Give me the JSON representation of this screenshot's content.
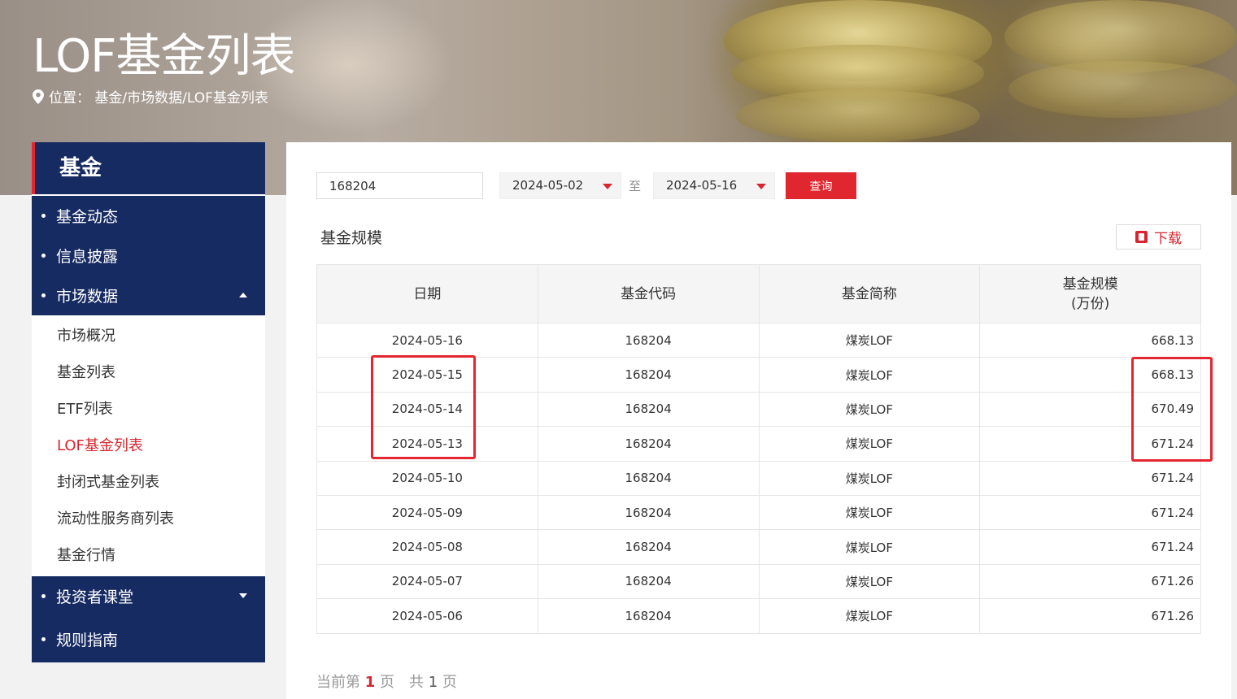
{
  "banner": {
    "title": "LOF基金列表",
    "breadcrumb": "位置：  基金/市场数据/LOF基金列表"
  },
  "sidebar": {
    "header": "基金",
    "items": [
      {
        "label": "基金动态"
      },
      {
        "label": "信息披露"
      },
      {
        "label": "市场数据"
      }
    ],
    "sub_items": [
      {
        "label": "市场概况"
      },
      {
        "label": "基金列表"
      },
      {
        "label": "ETF列表"
      },
      {
        "label": "LOF基金列表"
      },
      {
        "label": "封闭式基金列表"
      },
      {
        "label": "流动性服务商列表"
      },
      {
        "label": "基金行情"
      }
    ],
    "bottom_items": [
      {
        "label": "投资者课堂"
      },
      {
        "label": "规则指南"
      }
    ]
  },
  "filter": {
    "code_value": "168204",
    "start_date": "2024-05-02",
    "to_label": "至",
    "end_date": "2024-05-16",
    "query_label": "查询"
  },
  "section": {
    "title": "基金规模",
    "download_label": "下载"
  },
  "table": {
    "headers": [
      "日期",
      "基金代码",
      "基金简称",
      "基金规模"
    ],
    "scale_unit": "(万份)",
    "rows": [
      {
        "date": "2024-05-16",
        "code": "168204",
        "name": "煤炭LOF",
        "scale": "668.13"
      },
      {
        "date": "2024-05-15",
        "code": "168204",
        "name": "煤炭LOF",
        "scale": "668.13"
      },
      {
        "date": "2024-05-14",
        "code": "168204",
        "name": "煤炭LOF",
        "scale": "670.49"
      },
      {
        "date": "2024-05-13",
        "code": "168204",
        "name": "煤炭LOF",
        "scale": "671.24"
      },
      {
        "date": "2024-05-10",
        "code": "168204",
        "name": "煤炭LOF",
        "scale": "671.24"
      },
      {
        "date": "2024-05-09",
        "code": "168204",
        "name": "煤炭LOF",
        "scale": "671.24"
      },
      {
        "date": "2024-05-08",
        "code": "168204",
        "name": "煤炭LOF",
        "scale": "671.24"
      },
      {
        "date": "2024-05-07",
        "code": "168204",
        "name": "煤炭LOF",
        "scale": "671.26"
      },
      {
        "date": "2024-05-06",
        "code": "168204",
        "name": "煤炭LOF",
        "scale": "671.26"
      }
    ]
  },
  "pager": {
    "prefix": "当前第",
    "current": "1",
    "mid": "页　共",
    "total": "1",
    "suffix": "页"
  },
  "colors": {
    "navy": "#172b63",
    "accent_red": "#e3262f"
  }
}
